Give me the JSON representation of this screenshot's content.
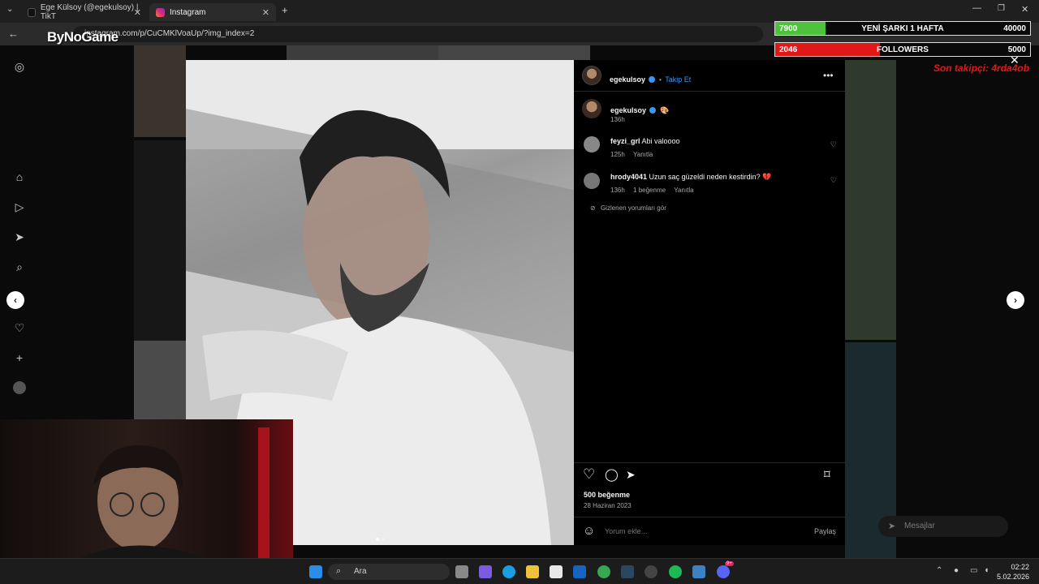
{
  "browser": {
    "tabs": [
      {
        "title": "Ege Külsoy (@egekulsoy) | TikT",
        "active": false
      },
      {
        "title": "Instagram",
        "active": true
      }
    ],
    "new_tab": "+",
    "url": "instagram.com/p/CuCMKlVoaUp/?img_index=2"
  },
  "overlay": {
    "logo": "ByNoGame",
    "goal_bar": {
      "current": "7900",
      "label": "YENİ ŞARKI 1 HAFTA",
      "target": "40000",
      "progress": 0.1975,
      "color": "#4cc33a"
    },
    "followers_bar": {
      "current": "2046",
      "label": "FOLLOWERS",
      "target": "5000",
      "progress": 0.41,
      "color": "#e01818"
    },
    "last_follower": "Son takipçi: 4rda4ob"
  },
  "post": {
    "author": "egekulsoy",
    "follow_label": "Takip Et",
    "more_icon": "more-horizontal-icon",
    "caption": {
      "username": "egekulsoy",
      "emoji": "🎨",
      "time": "136h"
    },
    "comments": [
      {
        "username": "feyzi_grl",
        "text": "Abi valoooo",
        "time": "125h",
        "reply": "Yanıtla",
        "likes": ""
      },
      {
        "username": "hrody4041",
        "text": "Uzun saç güzeldi neden kestirdin? 💔",
        "time": "136h",
        "likes": "1 beğenme",
        "reply": "Yanıtla"
      }
    ],
    "hidden_comments": "Gizlenen yorumları gör",
    "likes": "500 beğenme",
    "date": "28 Haziran 2023",
    "comment_placeholder": "Yorum ekle...",
    "share_label": "Paylaş"
  },
  "messages_label": "Mesajlar",
  "taskbar": {
    "search_label": "Ara",
    "time": "02:22",
    "date": "5.02.2026",
    "discord_badge": "9+"
  },
  "colors": {
    "accent": "#3897f0",
    "panel_bg": "#000000",
    "follow_link": "#3897f0"
  }
}
